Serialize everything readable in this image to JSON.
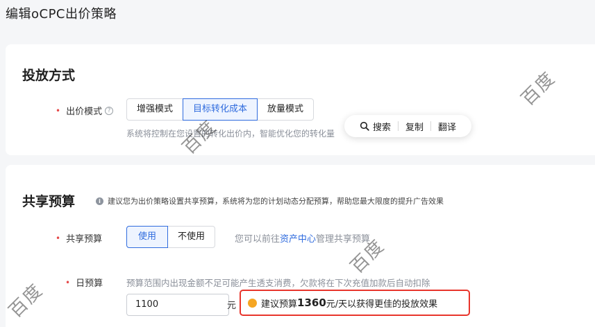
{
  "page": {
    "title": "编辑oCPC出价策略"
  },
  "delivery": {
    "section_title": "投放方式",
    "bid_mode": {
      "label": "出价模式",
      "options": [
        "增强模式",
        "目标转化成本",
        "放量模式"
      ],
      "selected": "目标转化成本",
      "description": "系统将控制在您设置的转化出价内，智能优化您的转化量"
    }
  },
  "context_menu": {
    "items": [
      {
        "label": "搜索",
        "icon": "search-icon"
      },
      {
        "label": "复制"
      },
      {
        "label": "翻译"
      }
    ]
  },
  "shared_budget": {
    "section_title": "共享预算",
    "info_text": "建议您为出价策略设置共享预算，系统将为您的计划动态分配预算，帮助您最大限度的提升广告效果",
    "field": {
      "label": "共享预算",
      "options": [
        "使用",
        "不使用"
      ],
      "selected": "使用",
      "hint_prefix": "您可以前往",
      "hint_link": "资产中心",
      "hint_suffix": "管理共享预算"
    },
    "daily": {
      "label": "日预算",
      "warning": "预算范围内出现金额不足可能产生透支消费，欠款将在下次充值加款后自动扣除",
      "value": "1100",
      "unit": "元",
      "suggest_prefix": "建议预算",
      "suggest_amount": "1360",
      "suggest_suffix": "元/天以获得更佳的投放效果"
    }
  },
  "watermark": "百度",
  "colors": {
    "accent": "#2f6bde",
    "required": "#e54848",
    "highlight_border": "#e8342b",
    "bulb": "#f5a623"
  }
}
